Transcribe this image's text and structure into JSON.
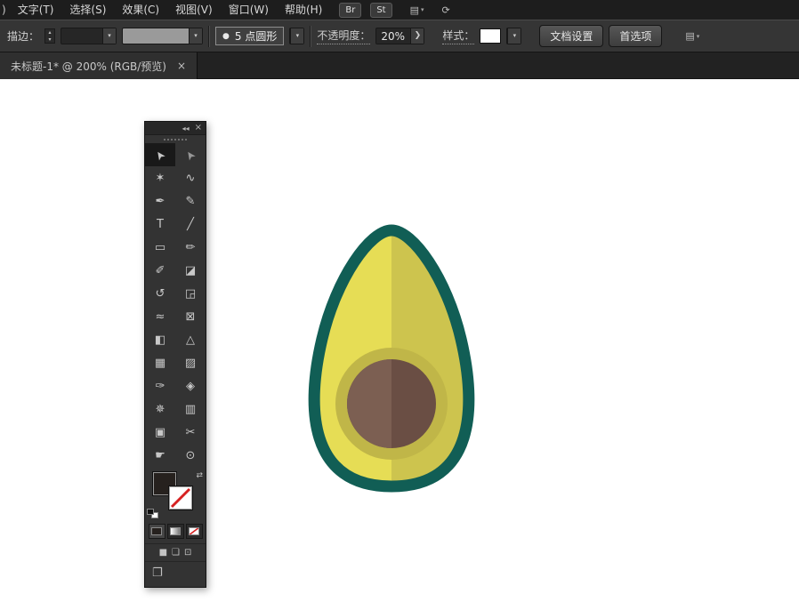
{
  "menu_bar": {
    "overflow_label": ")",
    "items": [
      "文字(T)",
      "选择(S)",
      "效果(C)",
      "视图(V)",
      "窗口(W)",
      "帮助(H)"
    ],
    "br_label": "Br",
    "st_label": "St",
    "workspace_icon_glyph": "▤",
    "share_icon_glyph": "⟳",
    "caret_glyph": "▾"
  },
  "options_bar": {
    "stroke_label": "描边：",
    "stepper_up_glyph": "▴",
    "stepper_down_glyph": "▾",
    "stroke_weight_value": "",
    "width_profile_value": "",
    "brush_bullet_glyph": "●",
    "brush_name": "5 点圆形",
    "opacity_label": "不透明度：",
    "opacity_value": "20%",
    "opacity_arrow_glyph": "❯",
    "style_label": "样式：",
    "document_setup_label": "文档设置",
    "preferences_label": "首选项",
    "arrange_icon_glyph": "▤",
    "caret_glyph": "▾"
  },
  "document_tab": {
    "title": "未标题-1* @ 200% (RGB/预览)",
    "close_glyph": "×"
  },
  "tools_panel": {
    "collapse_glyph": "◂◂",
    "close_glyph": "×",
    "tools": [
      {
        "name": "selection",
        "glyph": "➤"
      },
      {
        "name": "direct-selection",
        "glyph": "➤"
      },
      {
        "name": "magic-wand",
        "glyph": "✶"
      },
      {
        "name": "lasso",
        "glyph": "∿"
      },
      {
        "name": "pen",
        "glyph": "✒"
      },
      {
        "name": "paintbrush",
        "glyph": "✎"
      },
      {
        "name": "type",
        "glyph": "T"
      },
      {
        "name": "line-segment",
        "glyph": "╱"
      },
      {
        "name": "rectangle",
        "glyph": "▭"
      },
      {
        "name": "pencil",
        "glyph": "✏"
      },
      {
        "name": "blob-brush",
        "glyph": "✐"
      },
      {
        "name": "eraser",
        "glyph": "◪"
      },
      {
        "name": "rotate",
        "glyph": "↺"
      },
      {
        "name": "scale",
        "glyph": "◲"
      },
      {
        "name": "width",
        "glyph": "≈"
      },
      {
        "name": "free-transform",
        "glyph": "⊠"
      },
      {
        "name": "shape-builder",
        "glyph": "◧"
      },
      {
        "name": "perspective-grid",
        "glyph": "△"
      },
      {
        "name": "mesh",
        "glyph": "▦"
      },
      {
        "name": "gradient",
        "glyph": "▨"
      },
      {
        "name": "eyedropper",
        "glyph": "✑"
      },
      {
        "name": "blend",
        "glyph": "◈"
      },
      {
        "name": "symbol-sprayer",
        "glyph": "✵"
      },
      {
        "name": "column-graph",
        "glyph": "▥"
      },
      {
        "name": "artboard",
        "glyph": "▣"
      },
      {
        "name": "slice",
        "glyph": "✂"
      },
      {
        "name": "hand",
        "glyph": "☛"
      },
      {
        "name": "zoom",
        "glyph": "⊙"
      }
    ],
    "swatches": {
      "fill_color": "#26211e",
      "slash_color": "#d62121",
      "swap_glyph": "⇄"
    },
    "draw_modes": [
      {
        "name": "draw-normal",
        "glyph": "■"
      },
      {
        "name": "draw-behind",
        "glyph": "❏"
      },
      {
        "name": "draw-inside",
        "glyph": "⊡"
      }
    ],
    "screen_mode_glyph": "❐"
  },
  "artwork": {
    "colors": {
      "outline": "#115e55",
      "flesh_light": "#e6dd55",
      "flesh_dark": "#cdc44e",
      "ring": "#c0b648",
      "pit_light": "#7c5f52",
      "pit_dark": "#6a4e44"
    }
  }
}
